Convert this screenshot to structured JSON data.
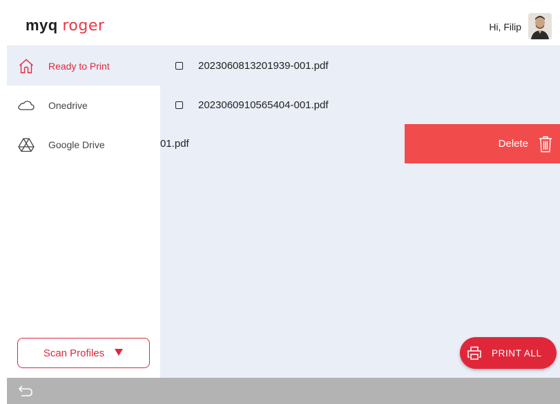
{
  "header": {
    "logo_brand": "myq",
    "logo_product": "roger",
    "greeting": "Hi, Filip"
  },
  "sidebar": {
    "items": [
      {
        "label": "Ready to Print",
        "icon": "home-icon",
        "active": true
      },
      {
        "label": "Onedrive",
        "icon": "cloud-icon",
        "active": false
      },
      {
        "label": "Google Drive",
        "icon": "google-drive-icon",
        "active": false
      }
    ],
    "scan_button_label": "Scan Profiles",
    "scan_button_icon": "caret-down-icon"
  },
  "files": [
    {
      "name": "2023060813201939-001.pdf"
    },
    {
      "name": "2023060910565404-001.pdf"
    },
    {
      "name": "01.pdf",
      "swiped": true
    }
  ],
  "delete_action": {
    "label": "Delete",
    "icon": "trash-icon"
  },
  "print_all": {
    "label": "PRINT ALL",
    "icon": "printer-icon"
  },
  "bottombar": {
    "back_icon": "back-arrow-icon"
  },
  "colors": {
    "accent": "#e0273a",
    "delete_bg": "#f24b4b",
    "content_bg": "#eaeef7",
    "bottom_bar": "#b3b3b3"
  }
}
